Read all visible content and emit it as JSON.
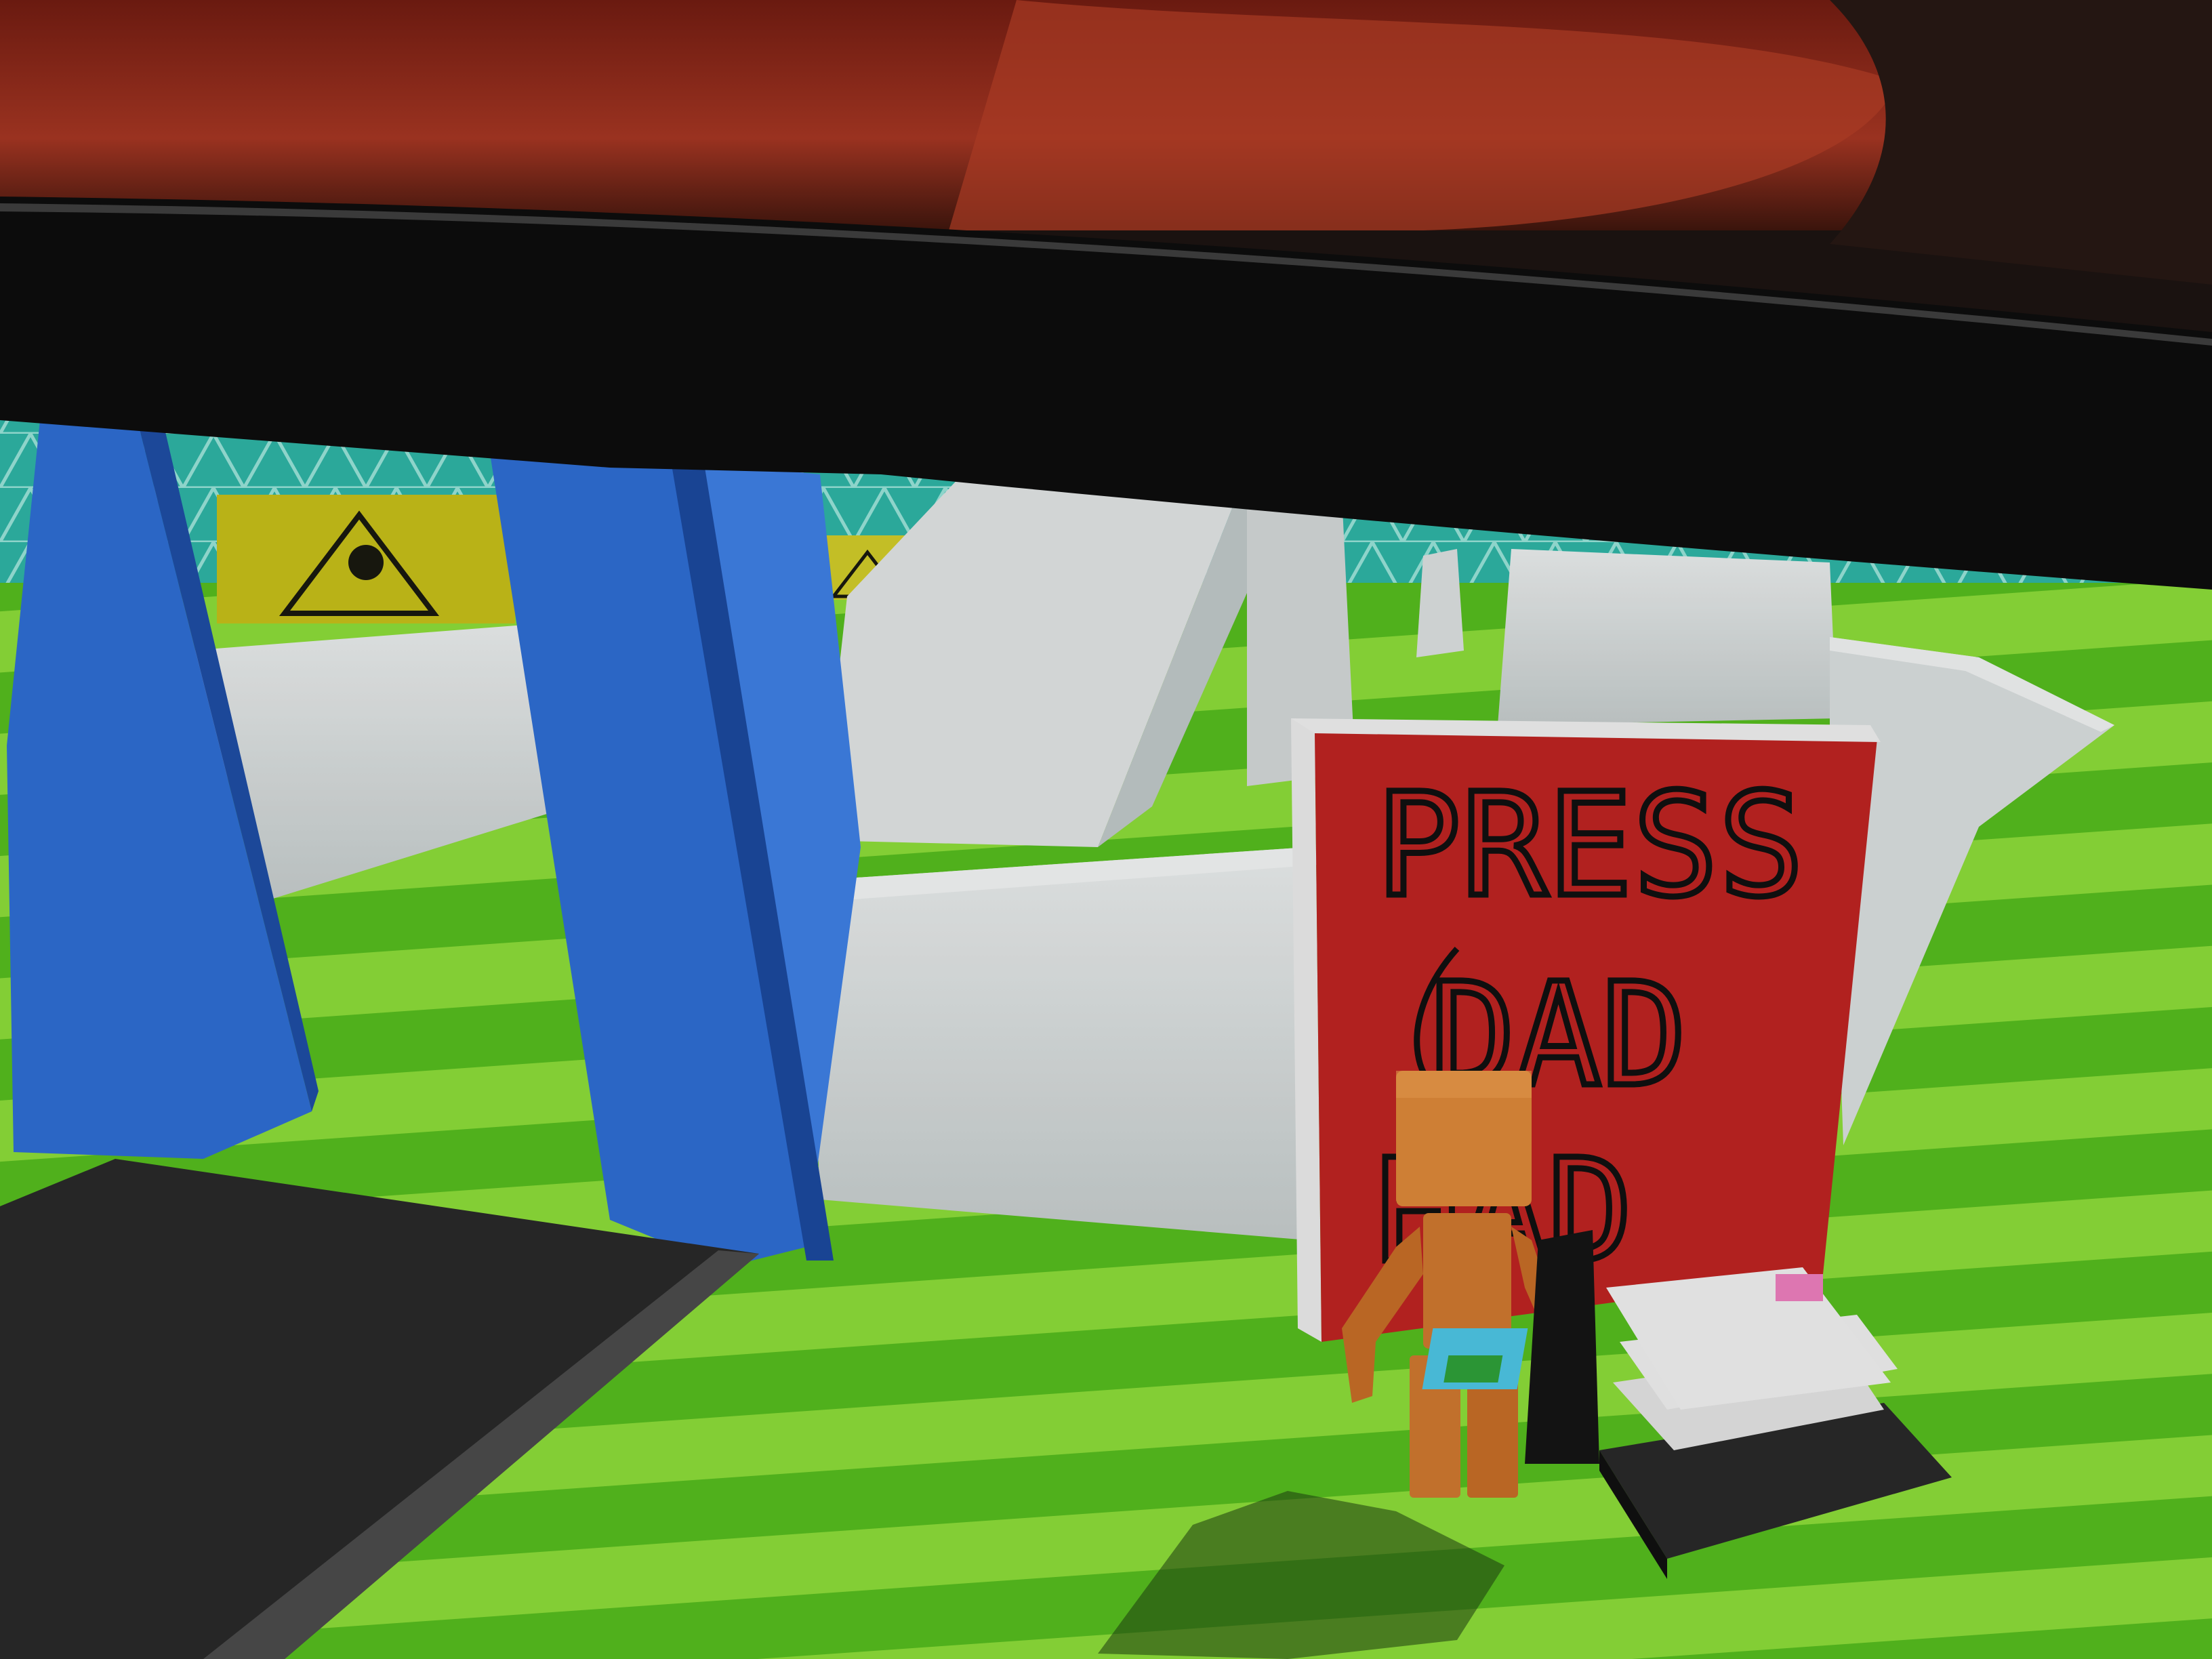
{
  "scene": {
    "type": "3d-game-viewport-photographed-on-monitor",
    "colors": {
      "blanket": "#8a2a1a",
      "monitor_bezel": "#0c0c0c",
      "grass_light": "#8fe03a",
      "grass_dark": "#52b81e",
      "walls": "#d9dede",
      "pillars": "#2f6fd6",
      "sign_board": "#c02422",
      "character": "#e08a3a",
      "backdrop": "#2fb7a8",
      "warning_sign": "#c9c21a"
    },
    "sign": {
      "text_lines": [
        "PRESS",
        "DAD",
        "HAD"
      ]
    },
    "objects": [
      "red-drawn-sign",
      "orange-wooden-character",
      "stack-of-books",
      "blue-pillar",
      "white-maze-walls",
      "yellow-warning-signs",
      "black-ramp"
    ]
  }
}
